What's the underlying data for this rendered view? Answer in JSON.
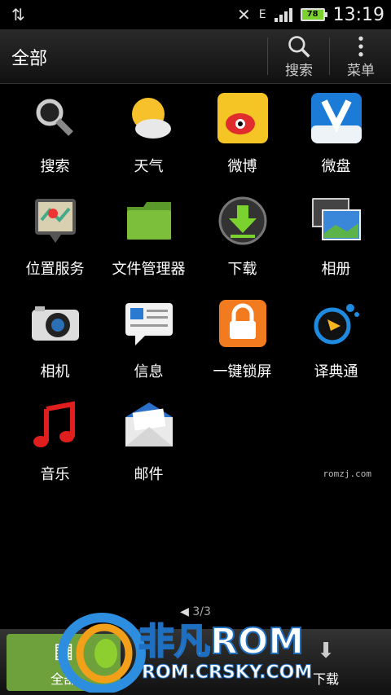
{
  "status": {
    "time": "13:19",
    "battery": "78",
    "network": "E"
  },
  "header": {
    "title": "全部",
    "search_label": "搜索",
    "menu_label": "菜单"
  },
  "apps": [
    {
      "label": "搜索"
    },
    {
      "label": "天气"
    },
    {
      "label": "微博"
    },
    {
      "label": "微盘"
    },
    {
      "label": "位置服务"
    },
    {
      "label": "文件管理器"
    },
    {
      "label": "下载"
    },
    {
      "label": "相册"
    },
    {
      "label": "相机"
    },
    {
      "label": "信息"
    },
    {
      "label": "一键锁屏"
    },
    {
      "label": "译典通"
    },
    {
      "label": "音乐"
    },
    {
      "label": "邮件"
    }
  ],
  "watermark": "romzj.com",
  "pager": "3/3",
  "bottom": {
    "tab_all_label": "全部",
    "tab_download_label": "下载"
  },
  "logo": {
    "brand": "非凡ROM",
    "url": "ROM.CRSKY.COM"
  },
  "icons": [
    "data-transfer-icon",
    "mute-icon",
    "signal-icon",
    "battery-icon",
    "search-icon",
    "menu-icon",
    "weather-icon",
    "weibo-icon",
    "vdisk-icon",
    "map-icon",
    "folder-icon",
    "download-icon",
    "gallery-icon",
    "camera-icon",
    "message-icon",
    "lock-icon",
    "dictionary-icon",
    "music-icon",
    "mail-icon",
    "grid-icon",
    "back-arrow-icon"
  ]
}
